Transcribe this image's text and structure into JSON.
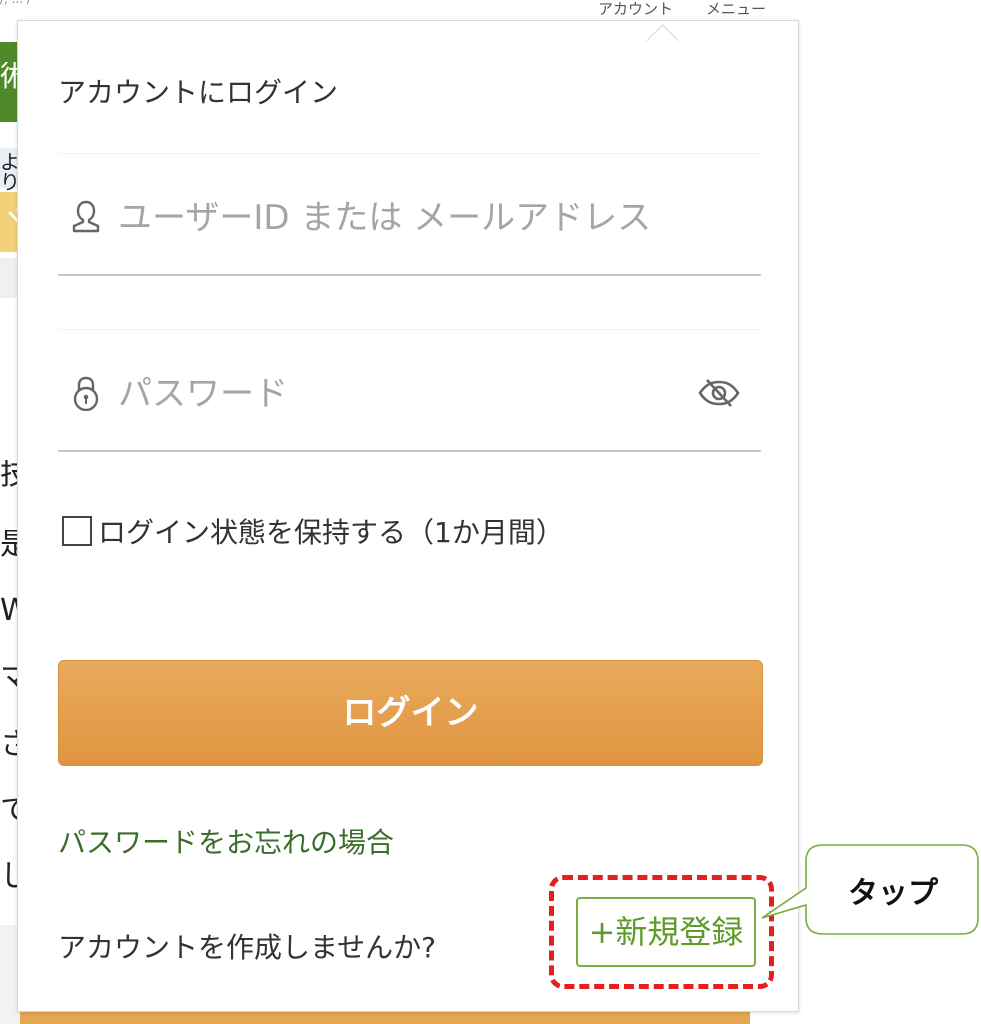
{
  "background": {
    "url_fragment": "/, ... /",
    "menu": [
      "アカウント",
      "メニュー"
    ],
    "side_chars": [
      "術",
      "より",
      "ヾ",
      "技",
      "是",
      "W",
      "マ",
      "さ",
      "て",
      "し"
    ]
  },
  "login_panel": {
    "title": "アカウントにログイン",
    "username_placeholder": "ユーザーID または メールアドレス",
    "password_placeholder": "パスワード",
    "remember_label": "ログイン状態を保持する（1か月間）",
    "login_button": "ログイン",
    "forgot_password": "パスワードをお忘れの場合",
    "create_account_prompt": "アカウントを作成しませんか?",
    "register_button": "+新規登録"
  },
  "annotation": {
    "callout_text": "タップ"
  },
  "colors": {
    "login_button": "#e6a04d",
    "link_green": "#3b6e2b",
    "register_green": "#79ad3e",
    "annotation_red": "#e3201b"
  },
  "icons": {
    "username": "user-icon",
    "password": "lock-icon",
    "toggle": "eye-slash-icon"
  }
}
